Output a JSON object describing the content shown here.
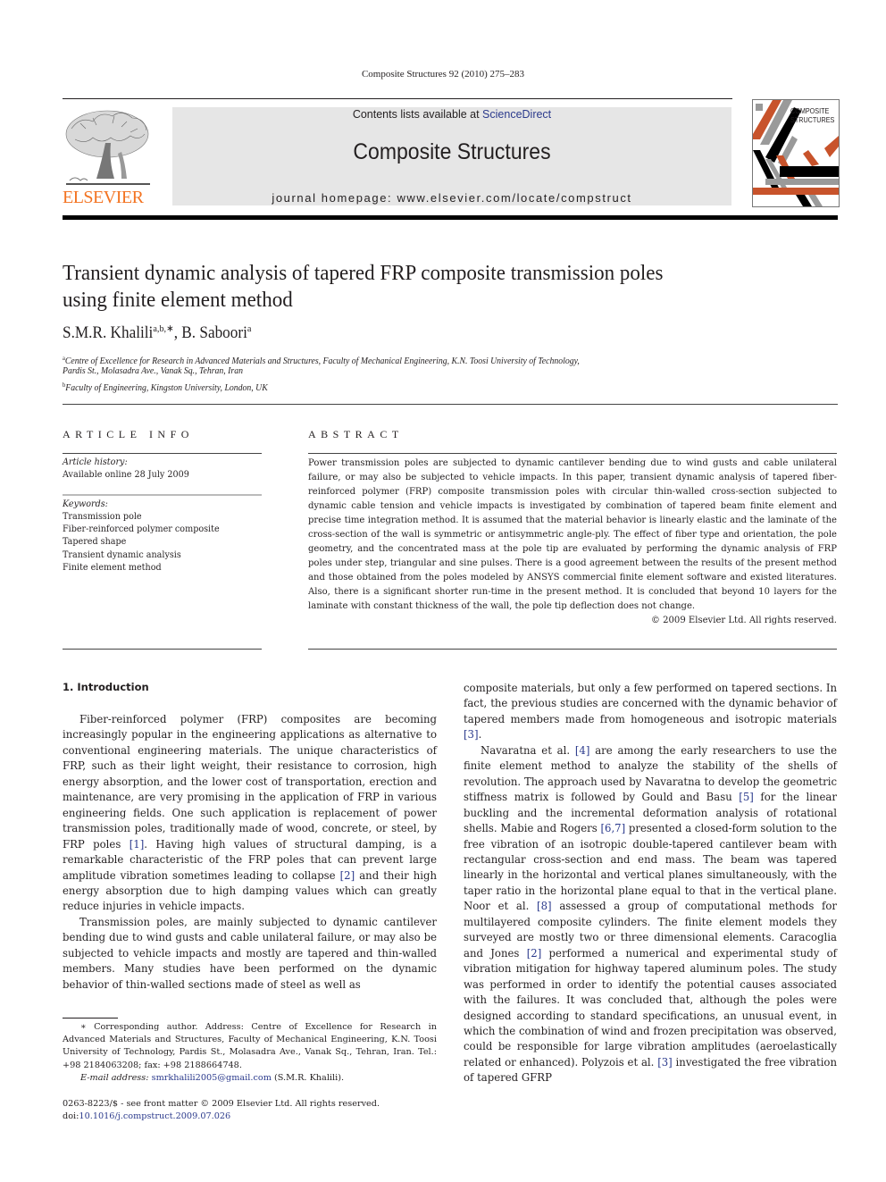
{
  "running_head": "Composite Structures 92 (2010) 275–283",
  "masthead": {
    "publisher_logo_text": "ELSEVIER",
    "contents_prefix": "Contents lists available at ",
    "contents_link": "ScienceDirect",
    "journal_name": "Composite Structures",
    "homepage": "journal homepage: www.elsevier.com/locate/compstruct",
    "cover_title_line1": "COMPOSITE",
    "cover_title_line2": "STRUCTURES",
    "colors": {
      "elsevier_orange": "#f37321",
      "link_blue": "#2b3a8c",
      "cover_orange": "#c8532b",
      "cover_gray": "#9a9a9a",
      "masthead_gray": "#e6e6e6"
    }
  },
  "article": {
    "title": "Transient dynamic analysis of tapered FRP composite transmission poles using finite element method",
    "authors": [
      {
        "name": "S.M.R. Khalili",
        "sup": "a,b,∗"
      },
      {
        "name": "B. Saboori",
        "sup": "a"
      }
    ],
    "author_separator": ", ",
    "affiliations": [
      {
        "label": "a",
        "line1": "Centre of Excellence for Research in Advanced Materials and Structures, Faculty of Mechanical Engineering, K.N. Toosi University of Technology,",
        "line2": "Pardis St., Molasadra Ave., Vanak Sq., Tehran, Iran"
      },
      {
        "label": "b",
        "line1": "Faculty of Engineering, Kingston University, London, UK"
      }
    ]
  },
  "article_info": {
    "heading": "ARTICLE INFO",
    "history_label": "Article history:",
    "history_value": "Available online 28 July 2009",
    "keywords_label": "Keywords:",
    "keywords": [
      "Transmission pole",
      "Fiber-reinforced polymer composite",
      "Tapered shape",
      "Transient dynamic analysis",
      "Finite element method"
    ]
  },
  "abstract": {
    "heading": "ABSTRACT",
    "text": "Power transmission poles are subjected to dynamic cantilever bending due to wind gusts and cable unilateral failure, or may also be subjected to vehicle impacts. In this paper, transient dynamic analysis of tapered fiber-reinforced polymer (FRP) composite transmission poles with circular thin-walled cross-section subjected to dynamic cable tension and vehicle impacts is investigated by combination of tapered beam finite element and precise time integration method. It is assumed that the material behavior is linearly elastic and the laminate of the cross-section of the wall is symmetric or antisymmetric angle-ply. The effect of fiber type and orientation, the pole geometry, and the concentrated mass at the pole tip are evaluated by performing the dynamic analysis of FRP poles under step, triangular and sine pulses. There is a good agreement between the results of the present method and those obtained from the poles modeled by ANSYS commercial finite element software and existed literatures. Also, there is a significant shorter run-time in the present method. It is concluded that beyond 10 layers for the laminate with constant thickness of the wall, the pole tip deflection does not change.",
    "copyright": "© 2009 Elsevier Ltd. All rights reserved."
  },
  "body": {
    "section_heading": "1. Introduction",
    "left": {
      "p1_a": "Fiber-reinforced polymer (FRP) composites are becoming increasingly popular in the engineering applications as alternative to conventional engineering materials. The unique characteristics of FRP, such as their light weight, their resistance to corrosion, high energy absorption, and the lower cost of transportation, erection and maintenance, are very promising in the application of FRP in various engineering fields. One such application is replacement of power transmission poles, traditionally made of wood, concrete, or steel, by FRP poles ",
      "p1_ref1": "[1]",
      "p1_b": ". Having high values of structural damping, is a remarkable characteristic of the FRP poles that can prevent large amplitude vibration sometimes leading to collapse ",
      "p1_ref2": "[2]",
      "p1_c": " and their high energy absorption due to high damping values which can greatly reduce injuries in vehicle impacts.",
      "p2": "Transmission poles, are mainly subjected to dynamic cantilever bending due to wind gusts and cable unilateral failure, or may also be subjected to vehicle impacts and mostly are tapered and thin-walled members. Many studies have been performed on the dynamic behavior of thin-walled sections made of steel as well as"
    },
    "right": {
      "p1_a": "composite materials, but only a few performed on tapered sections. In fact, the previous studies are concerned with the dynamic behavior of tapered members made from homogeneous and isotropic materials ",
      "p1_ref3": "[3]",
      "p1_b": ".",
      "p2_a": "Navaratna et al. ",
      "p2_ref4": "[4]",
      "p2_b": " are among the early researchers to use the finite element method to analyze the stability of the shells of revolution. The approach used by Navaratna to develop the geometric stiffness matrix is followed by Gould and Basu ",
      "p2_ref5": "[5]",
      "p2_c": " for the linear buckling and the incremental deformation analysis of rotational shells. Mabie and Rogers ",
      "p2_ref67": "[6,7]",
      "p2_d": " presented a closed-form solution to the free vibration of an isotropic double-tapered cantilever beam with rectangular cross-section and end mass. The beam was tapered linearly in the horizontal and vertical planes simultaneously, with the taper ratio in the horizontal plane equal to that in the vertical plane. Noor et al. ",
      "p2_ref8": "[8]",
      "p2_e": " assessed a group of computational methods for multilayered composite cylinders. The finite element models they surveyed are mostly two or three dimensional elements. Caracoglia and Jones ",
      "p2_ref2": "[2]",
      "p2_f": " performed a numerical and experimental study of vibration mitigation for highway tapered aluminum poles. The study was performed in order to identify the potential causes associated with the failures. It was concluded that, although the poles were designed according to standard specifications, an unusual event, in which the combination of wind and frozen precipitation was observed, could be responsible for large vibration amplitudes (aeroelastically related or enhanced). Polyzois et al. ",
      "p2_ref3": "[3]",
      "p2_g": " investigated the free vibration of tapered GFRP"
    }
  },
  "footnote": {
    "corresponding": "∗ Corresponding author. Address: Centre of Excellence for Research in Advanced Materials and Structures, Faculty of Mechanical Engineering, K.N. Toosi University of Technology, Pardis St., Molasadra Ave., Vanak Sq., Tehran, Iran. Tel.: +98 2184063208; fax: +98 2188664748.",
    "email_label": "E-mail address: ",
    "email": "smrkhalili2005@gmail.com",
    "email_suffix": " (S.M.R. Khalili)."
  },
  "front_matter": {
    "issn_line": "0263-8223/$ - see front matter © 2009 Elsevier Ltd. All rights reserved.",
    "doi_prefix": "doi:",
    "doi": "10.1016/j.compstruct.2009.07.026"
  }
}
